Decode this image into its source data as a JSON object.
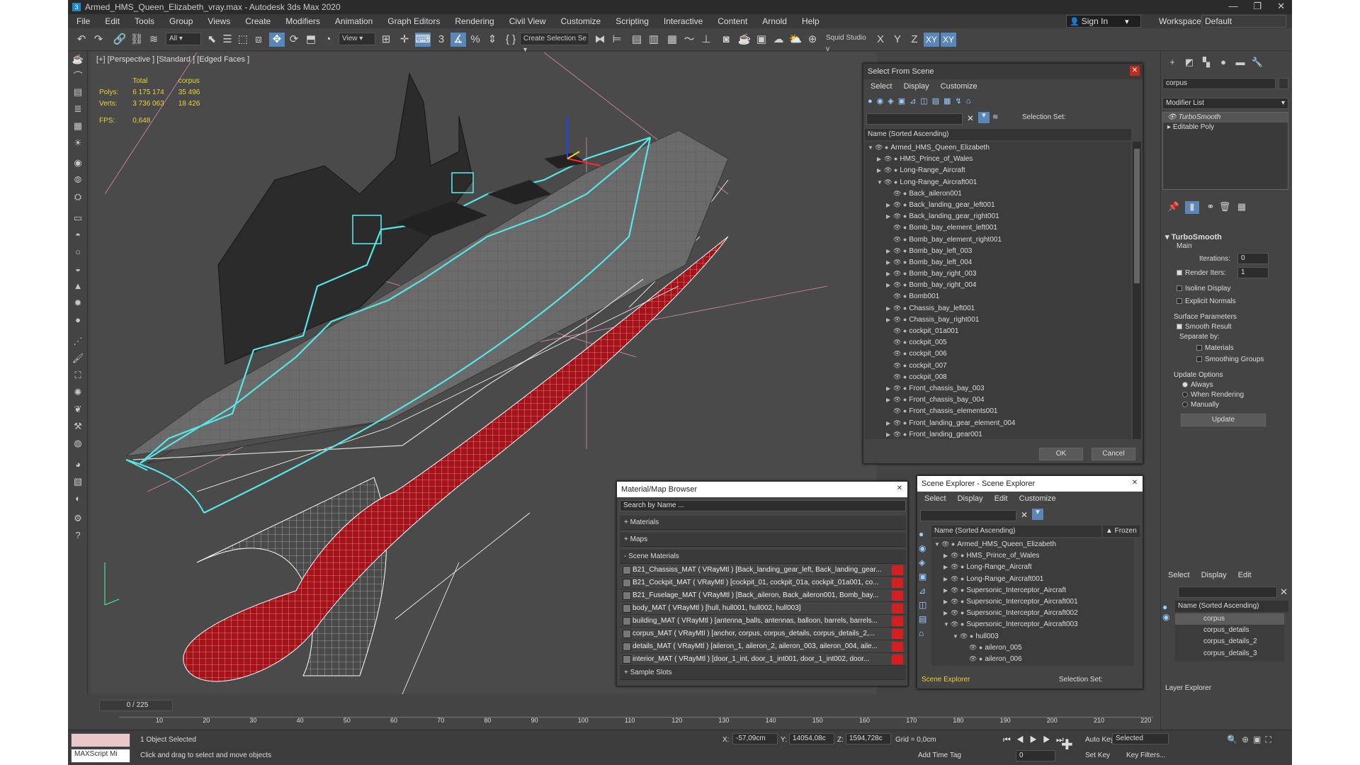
{
  "window": {
    "title": "Armed_HMS_Queen_Elizabeth_vray.max - Autodesk 3ds Max 2020",
    "logo": "3"
  },
  "menu": [
    "File",
    "Edit",
    "Tools",
    "Group",
    "Views",
    "Create",
    "Modifiers",
    "Animation",
    "Graph Editors",
    "Rendering",
    "Civil View",
    "Customize",
    "Scripting",
    "Interactive",
    "Content",
    "Arnold",
    "Help"
  ],
  "signin": "Sign In",
  "workspaces_label": "Workspaces:",
  "workspace": "Default",
  "toolbar": {
    "filter": "All",
    "refcoord": "View",
    "selset": "Create Selection Se",
    "studio": "Squid Studio v",
    "axes": [
      "X",
      "Y",
      "Z",
      "XY",
      "XY"
    ]
  },
  "viewport": {
    "label": "[+] [Perspective ] [Standard ] [Edged Faces ]",
    "stats": {
      "h_total": "Total",
      "h_sel": "corpus",
      "polys_l": "Polys:",
      "polys_t": "6 175 174",
      "polys_s": "35 496",
      "verts_l": "Verts:",
      "verts_t": "3 736 063",
      "verts_s": "18 426",
      "fps_l": "FPS:",
      "fps_v": "0,648"
    }
  },
  "select_from_scene": {
    "title": "Select From Scene",
    "menu": [
      "Select",
      "Display",
      "Customize"
    ],
    "selset": "Selection Set:",
    "header": "Name (Sorted Ascending)",
    "items": [
      {
        "n": "Armed_HMS_Queen_Elizabeth",
        "lvl": 0,
        "exp": "open"
      },
      {
        "n": "HMS_Prince_of_Wales",
        "lvl": 1,
        "exp": "closed"
      },
      {
        "n": "Long-Range_Aircraft",
        "lvl": 1,
        "exp": "closed"
      },
      {
        "n": "Long-Range_Aircraft001",
        "lvl": 1,
        "exp": "open"
      },
      {
        "n": "Back_aileron001",
        "lvl": 2,
        "exp": ""
      },
      {
        "n": "Back_landing_gear_left001",
        "lvl": 2,
        "exp": "closed"
      },
      {
        "n": "Back_landing_gear_right001",
        "lvl": 2,
        "exp": "closed"
      },
      {
        "n": "Bomb_bay_element_left001",
        "lvl": 2,
        "exp": ""
      },
      {
        "n": "Bomb_bay_element_right001",
        "lvl": 2,
        "exp": ""
      },
      {
        "n": "Bomb_bay_left_003",
        "lvl": 2,
        "exp": "closed"
      },
      {
        "n": "Bomb_bay_left_004",
        "lvl": 2,
        "exp": "closed"
      },
      {
        "n": "Bomb_bay_right_003",
        "lvl": 2,
        "exp": "closed"
      },
      {
        "n": "Bomb_bay_right_004",
        "lvl": 2,
        "exp": "closed"
      },
      {
        "n": "Bomb001",
        "lvl": 2,
        "exp": ""
      },
      {
        "n": "Chassis_bay_left001",
        "lvl": 2,
        "exp": "closed"
      },
      {
        "n": "Chassis_bay_right001",
        "lvl": 2,
        "exp": "closed"
      },
      {
        "n": "cockpit_01a001",
        "lvl": 2,
        "exp": ""
      },
      {
        "n": "cockpit_005",
        "lvl": 2,
        "exp": ""
      },
      {
        "n": "cockpit_006",
        "lvl": 2,
        "exp": ""
      },
      {
        "n": "cockpit_007",
        "lvl": 2,
        "exp": ""
      },
      {
        "n": "cockpit_008",
        "lvl": 2,
        "exp": ""
      },
      {
        "n": "Front_chassis_bay_003",
        "lvl": 2,
        "exp": "closed"
      },
      {
        "n": "Front_chassis_bay_004",
        "lvl": 2,
        "exp": "closed"
      },
      {
        "n": "Front_chassis_elements001",
        "lvl": 2,
        "exp": ""
      },
      {
        "n": "Front_landing_gear_element_004",
        "lvl": 2,
        "exp": "closed"
      },
      {
        "n": "Front_landing_gear001",
        "lvl": 2,
        "exp": "closed"
      }
    ],
    "ok": "OK",
    "cancel": "Cancel"
  },
  "material_browser": {
    "title": "Material/Map Browser",
    "search": "Search by Name ...",
    "sections": {
      "materials": "+ Materials",
      "maps": "+ Maps",
      "scene": "- Scene Materials",
      "slots": "+ Sample Slots"
    },
    "items": [
      "B21_Chassiss_MAT  ( VRayMtl ) [Back_landing_gear_left, Back_landing_gear...",
      "B21_Cockpit_MAT  ( VRayMtl ) [cockpit_01, cockpit_01a, cockpit_01a001, co...",
      "B21_Fuselage_MAT  ( VRayMtl ) [Back_aileron, Back_aileron001, Bomb_bay...",
      "body_MAT  ( VRayMtl ) [hull, hull001, hull002, hull003]",
      "building_MAT  ( VRayMtl ) [antenna_balls, antennas, balloon, barrels, barrels...",
      "corpus_MAT  ( VRayMtl ) [anchor, corpus, corpus_details, corpus_details_2,...",
      "details_MAT  ( VRayMtl ) [aileron_1, aileron_2, aileron_003, aileron_004, aile...",
      "interior_MAT  ( VRayMtl ) [door_1_int, door_1_int001, door_1_int002, door..."
    ]
  },
  "scene_explorer": {
    "title": "Scene Explorer - Scene Explorer",
    "menu": [
      "Select",
      "Display",
      "Edit",
      "Customize"
    ],
    "header": "Name (Sorted Ascending)",
    "frozen": "▲ Frozen",
    "items": [
      {
        "n": "Armed_HMS_Queen_Elizabeth",
        "lvl": 0,
        "exp": "open"
      },
      {
        "n": "HMS_Prince_of_Wales",
        "lvl": 1,
        "exp": "closed"
      },
      {
        "n": "Long-Range_Aircraft",
        "lvl": 1,
        "exp": "closed"
      },
      {
        "n": "Long-Range_Aircraft001",
        "lvl": 1,
        "exp": "closed"
      },
      {
        "n": "Supersonic_Interceptor_Aircraft",
        "lvl": 1,
        "exp": "closed"
      },
      {
        "n": "Supersonic_Interceptor_Aircraft001",
        "lvl": 1,
        "exp": "closed"
      },
      {
        "n": "Supersonic_Interceptor_Aircraft002",
        "lvl": 1,
        "exp": "closed"
      },
      {
        "n": "Supersonic_Interceptor_Aircraft003",
        "lvl": 1,
        "exp": "open"
      },
      {
        "n": "hull003",
        "lvl": 2,
        "exp": "open"
      },
      {
        "n": "aileron_005",
        "lvl": 3,
        "exp": ""
      },
      {
        "n": "aileron_006",
        "lvl": 3,
        "exp": ""
      }
    ],
    "footer": "Scene Explorer",
    "selset": "Selection Set:"
  },
  "command_panel": {
    "name_value": "corpus",
    "modifier_list": "Modifier List",
    "stack": [
      "TurboSmooth",
      "Editable Poly"
    ],
    "turbosmooth": {
      "title": "TurboSmooth",
      "main": "Main",
      "iterations_l": "Iterations:",
      "iterations_v": "0",
      "render_l": "Render Iters:",
      "render_v": "1",
      "isoline": "Isoline Display",
      "explicit": "Explicit Normals",
      "surface": "Surface Parameters",
      "smooth": "Smooth Result",
      "separate": "Separate by:",
      "materials": "Materials",
      "smoothing": "Smoothing Groups",
      "update_opts": "Update Options",
      "always": "Always",
      "when_rendering": "When Rendering",
      "manually": "Manually",
      "update": "Update"
    }
  },
  "layer_explorer": {
    "menu": [
      "Select",
      "Display",
      "Edit"
    ],
    "header": "Name (Sorted Ascending)",
    "items": [
      "corpus",
      "corpus_details",
      "corpus_details_2",
      "corpus_details_3"
    ],
    "footer": "Layer Explorer"
  },
  "timeline": {
    "frame": "0 / 225",
    "ticks": [
      "10",
      "20",
      "30",
      "40",
      "50",
      "60",
      "70",
      "80",
      "90",
      "100",
      "110",
      "120",
      "130",
      "140",
      "150",
      "160",
      "170",
      "180",
      "190",
      "200",
      "210",
      "220"
    ]
  },
  "status": {
    "maxscript": "MAXScript Mi",
    "selected": "1 Object Selected",
    "hint": "Click and drag to select and move objects",
    "x_l": "X:",
    "x_v": "-57,09cm",
    "y_l": "Y:",
    "y_v": "14054,08c",
    "z_l": "Z:",
    "z_v": "1594,728c",
    "grid": "Grid = 0,0cm",
    "timetag": "Add Time Tag",
    "autokey": "Auto Key",
    "selected_dd": "Selected",
    "setkey": "Set Key",
    "keyfilters": "Key Filters...",
    "frame": "0"
  },
  "colors": {
    "selection": "#56e6e6",
    "hull_red": "#a5121a",
    "stats_yellow": "#e8d23a",
    "accent": "#5a87b8"
  }
}
